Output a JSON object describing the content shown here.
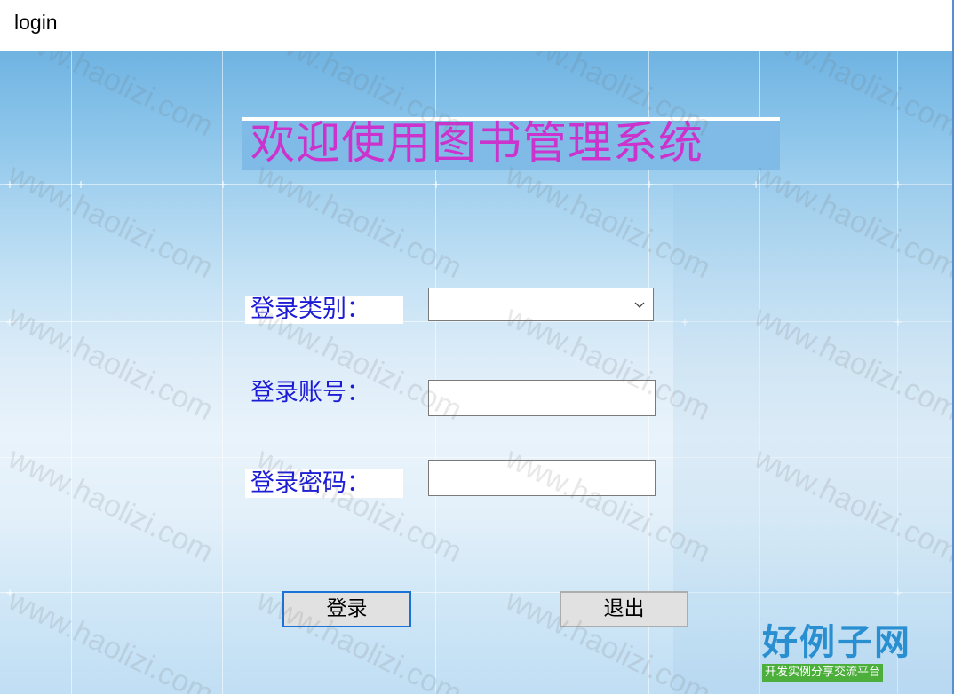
{
  "window": {
    "title": "login"
  },
  "main": {
    "heading": "欢迎使用图书管理系统",
    "fields": {
      "category_label": "登录类别：",
      "category_value": "",
      "account_label": "登录账号：",
      "account_value": "",
      "password_label": "登录密码：",
      "password_value": ""
    },
    "buttons": {
      "login": "登录",
      "exit": "退出"
    }
  },
  "watermark": {
    "text": "www.haolizi.com",
    "logo_main": "好例子网",
    "logo_sub": "开发实例分享交流平台"
  },
  "colors": {
    "heading": "#cc33cc",
    "label": "#1c1cd6",
    "login_button_border": "#1a72d6",
    "logo_green": "#4caf3c",
    "logo_blue": "#2a8fd0"
  },
  "icons": {
    "dropdown": "chevron-down-icon"
  }
}
